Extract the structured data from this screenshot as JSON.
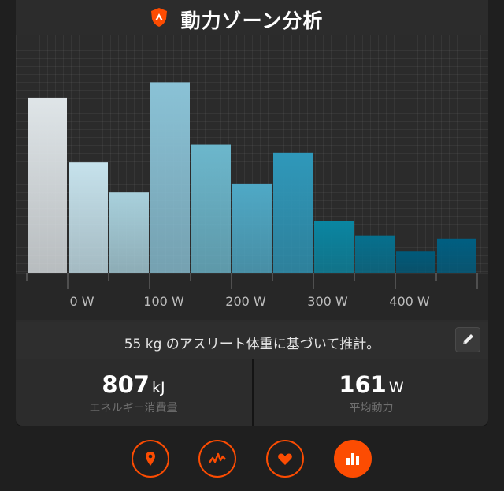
{
  "header": {
    "title": "動力ゾーン分析",
    "icon": "strava-shield-icon"
  },
  "chart_data": {
    "type": "bar",
    "xlabel": "",
    "ylabel": "",
    "tick_labels": [
      "0 W",
      "100 W",
      "200 W",
      "300 W",
      "400 W"
    ],
    "tick_values": [
      0,
      100,
      200,
      300,
      400
    ],
    "bin_width_w": 50,
    "bin_starts_w": [
      -50,
      0,
      50,
      100,
      150,
      200,
      250,
      300,
      350,
      400,
      450
    ],
    "values": [
      21.7,
      13.7,
      10.0,
      23.6,
      15.9,
      11.1,
      14.9,
      6.5,
      4.7,
      2.7,
      4.3
    ],
    "ylim": [
      0,
      25
    ],
    "grid": true,
    "colors": [
      "#dfe5e8",
      "#c6e2ec",
      "#a8d0dc",
      "#8ac2d6",
      "#6cb7cc",
      "#4fa9c6",
      "#2f98ba",
      "#0a86a2",
      "#06708e",
      "#005a7a",
      "#005f82"
    ]
  },
  "info": {
    "text": "55 kg のアスリート体重に基づいて推計。",
    "edit_icon": "pencil-icon"
  },
  "stats": {
    "energy": {
      "value": "807",
      "unit": "kJ",
      "label": "エネルギー消費量"
    },
    "power": {
      "value": "161",
      "unit": "W",
      "label": "平均動力"
    }
  },
  "nav": {
    "items": [
      {
        "icon": "map-pin-icon",
        "active": false
      },
      {
        "icon": "activity-graph-icon",
        "active": false
      },
      {
        "icon": "heart-icon",
        "active": false
      },
      {
        "icon": "bar-chart-icon",
        "active": true
      }
    ],
    "accent": "#fc4c02"
  }
}
